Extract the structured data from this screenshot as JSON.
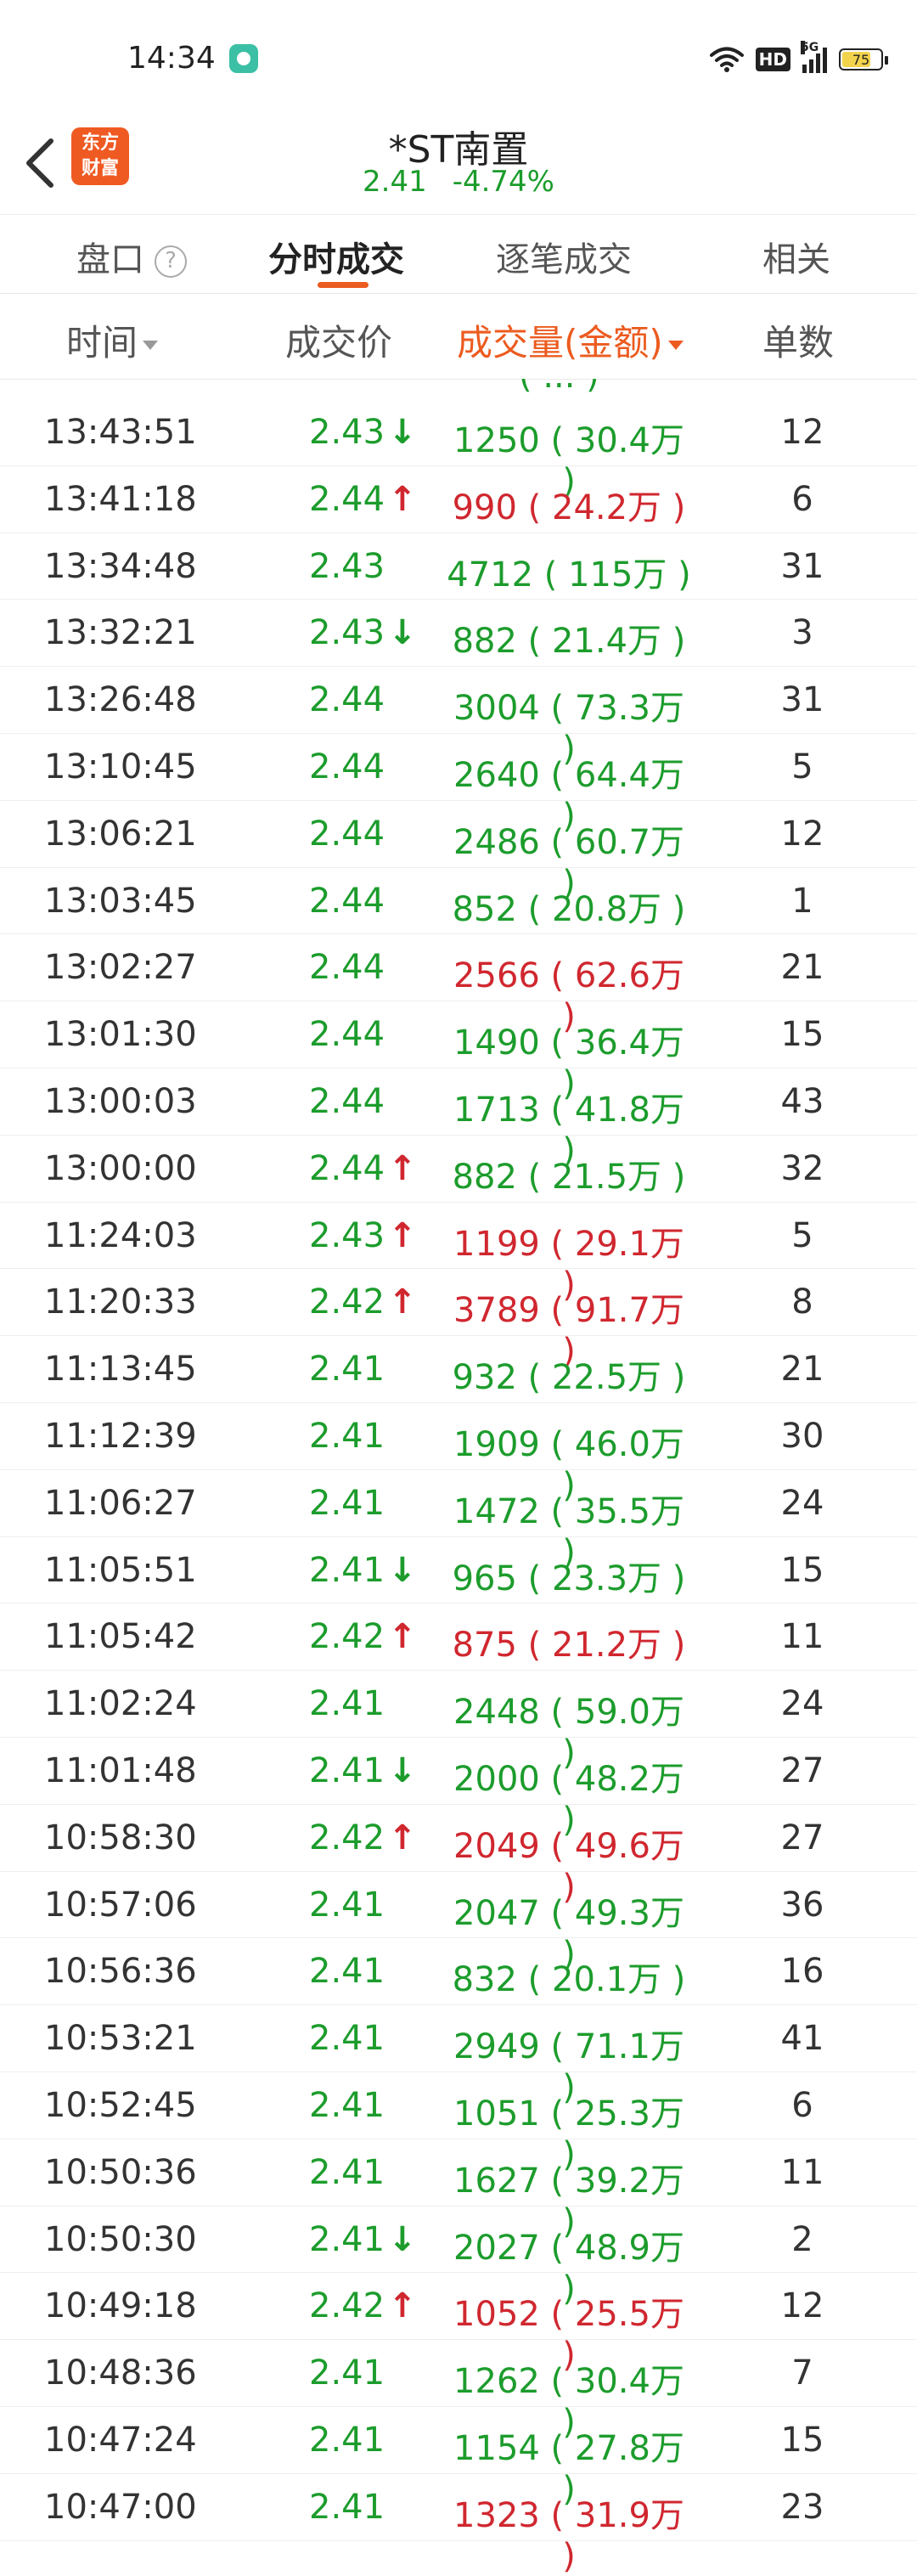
{
  "status": {
    "time": "14:34",
    "battery_level": "75",
    "battery_fraction": 0.75,
    "network": "5G",
    "hd_label": "HD"
  },
  "header": {
    "logo_line1": "东方",
    "logo_line2": "财富",
    "stock_name": "*ST南置",
    "price": "2.41",
    "change_pct": "-4.74%"
  },
  "tabs": [
    {
      "label": "盘口",
      "help": "?"
    },
    {
      "label": "分时成交"
    },
    {
      "label": "逐笔成交"
    },
    {
      "label": "相关"
    }
  ],
  "columns": {
    "time": "时间",
    "price": "成交价",
    "volume": "成交量(金额)",
    "count": "单数"
  },
  "peek_text": "( ... )",
  "colors": {
    "up": "#d0272f",
    "down": "#1c9c2c",
    "accent": "#ec5b1f"
  },
  "rows": [
    {
      "time": "13:43:51",
      "price": "2.43",
      "arrow": "down",
      "volume": "1250 ( 30.4万 )",
      "vol_dir": "down",
      "count": "12"
    },
    {
      "time": "13:41:18",
      "price": "2.44",
      "arrow": "up",
      "volume": "990 ( 24.2万 )",
      "vol_dir": "up",
      "count": "6"
    },
    {
      "time": "13:34:48",
      "price": "2.43",
      "arrow": "",
      "volume": "4712 ( 115万 )",
      "vol_dir": "down",
      "count": "31"
    },
    {
      "time": "13:32:21",
      "price": "2.43",
      "arrow": "down",
      "volume": "882 ( 21.4万 )",
      "vol_dir": "down",
      "count": "3"
    },
    {
      "time": "13:26:48",
      "price": "2.44",
      "arrow": "",
      "volume": "3004 ( 73.3万 )",
      "vol_dir": "down",
      "count": "31"
    },
    {
      "time": "13:10:45",
      "price": "2.44",
      "arrow": "",
      "volume": "2640 ( 64.4万 )",
      "vol_dir": "down",
      "count": "5"
    },
    {
      "time": "13:06:21",
      "price": "2.44",
      "arrow": "",
      "volume": "2486 ( 60.7万 )",
      "vol_dir": "down",
      "count": "12"
    },
    {
      "time": "13:03:45",
      "price": "2.44",
      "arrow": "",
      "volume": "852 ( 20.8万 )",
      "vol_dir": "down",
      "count": "1"
    },
    {
      "time": "13:02:27",
      "price": "2.44",
      "arrow": "",
      "volume": "2566 ( 62.6万 )",
      "vol_dir": "up",
      "count": "21"
    },
    {
      "time": "13:01:30",
      "price": "2.44",
      "arrow": "",
      "volume": "1490 ( 36.4万 )",
      "vol_dir": "down",
      "count": "15"
    },
    {
      "time": "13:00:03",
      "price": "2.44",
      "arrow": "",
      "volume": "1713 ( 41.8万 )",
      "vol_dir": "down",
      "count": "43"
    },
    {
      "time": "13:00:00",
      "price": "2.44",
      "arrow": "up",
      "volume": "882 ( 21.5万 )",
      "vol_dir": "down",
      "count": "32"
    },
    {
      "time": "11:24:03",
      "price": "2.43",
      "arrow": "up",
      "volume": "1199 ( 29.1万 )",
      "vol_dir": "up",
      "count": "5"
    },
    {
      "time": "11:20:33",
      "price": "2.42",
      "arrow": "up",
      "volume": "3789 ( 91.7万 )",
      "vol_dir": "up",
      "count": "8"
    },
    {
      "time": "11:13:45",
      "price": "2.41",
      "arrow": "",
      "volume": "932 ( 22.5万 )",
      "vol_dir": "down",
      "count": "21"
    },
    {
      "time": "11:12:39",
      "price": "2.41",
      "arrow": "",
      "volume": "1909 ( 46.0万 )",
      "vol_dir": "down",
      "count": "30"
    },
    {
      "time": "11:06:27",
      "price": "2.41",
      "arrow": "",
      "volume": "1472 ( 35.5万 )",
      "vol_dir": "down",
      "count": "24"
    },
    {
      "time": "11:05:51",
      "price": "2.41",
      "arrow": "down",
      "volume": "965 ( 23.3万 )",
      "vol_dir": "down",
      "count": "15"
    },
    {
      "time": "11:05:42",
      "price": "2.42",
      "arrow": "up",
      "volume": "875 ( 21.2万 )",
      "vol_dir": "up",
      "count": "11"
    },
    {
      "time": "11:02:24",
      "price": "2.41",
      "arrow": "",
      "volume": "2448 ( 59.0万 )",
      "vol_dir": "down",
      "count": "24"
    },
    {
      "time": "11:01:48",
      "price": "2.41",
      "arrow": "down",
      "volume": "2000 ( 48.2万 )",
      "vol_dir": "down",
      "count": "27"
    },
    {
      "time": "10:58:30",
      "price": "2.42",
      "arrow": "up",
      "volume": "2049 ( 49.6万 )",
      "vol_dir": "up",
      "count": "27"
    },
    {
      "time": "10:57:06",
      "price": "2.41",
      "arrow": "",
      "volume": "2047 ( 49.3万 )",
      "vol_dir": "down",
      "count": "36"
    },
    {
      "time": "10:56:36",
      "price": "2.41",
      "arrow": "",
      "volume": "832 ( 20.1万 )",
      "vol_dir": "down",
      "count": "16"
    },
    {
      "time": "10:53:21",
      "price": "2.41",
      "arrow": "",
      "volume": "2949 ( 71.1万 )",
      "vol_dir": "down",
      "count": "41"
    },
    {
      "time": "10:52:45",
      "price": "2.41",
      "arrow": "",
      "volume": "1051 ( 25.3万 )",
      "vol_dir": "down",
      "count": "6"
    },
    {
      "time": "10:50:36",
      "price": "2.41",
      "arrow": "",
      "volume": "1627 ( 39.2万 )",
      "vol_dir": "down",
      "count": "11"
    },
    {
      "time": "10:50:30",
      "price": "2.41",
      "arrow": "down",
      "volume": "2027 ( 48.9万 )",
      "vol_dir": "down",
      "count": "2"
    },
    {
      "time": "10:49:18",
      "price": "2.42",
      "arrow": "up",
      "volume": "1052 ( 25.5万 )",
      "vol_dir": "up",
      "count": "12"
    },
    {
      "time": "10:48:36",
      "price": "2.41",
      "arrow": "",
      "volume": "1262 ( 30.4万 )",
      "vol_dir": "down",
      "count": "7"
    },
    {
      "time": "10:47:24",
      "price": "2.41",
      "arrow": "",
      "volume": "1154 ( 27.8万 )",
      "vol_dir": "down",
      "count": "15"
    },
    {
      "time": "10:47:00",
      "price": "2.41",
      "arrow": "",
      "volume": "1323 ( 31.9万 )",
      "vol_dir": "up",
      "count": "23"
    }
  ]
}
